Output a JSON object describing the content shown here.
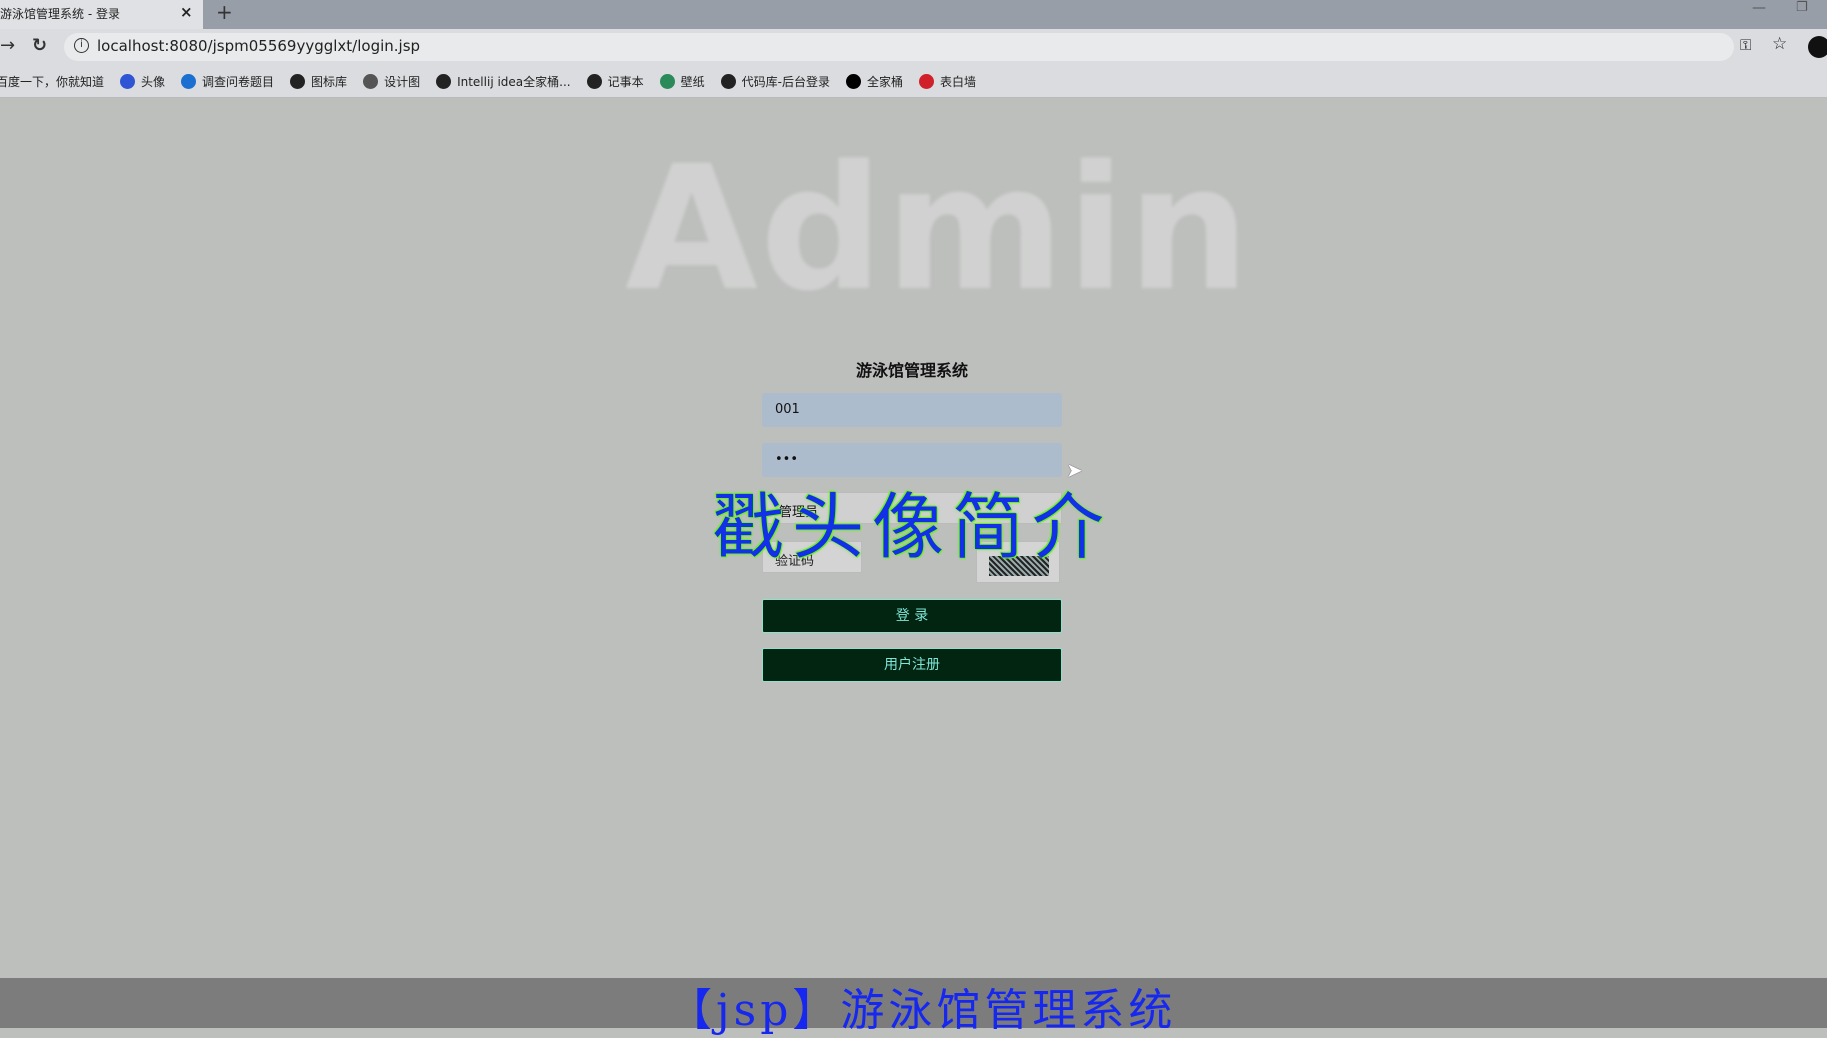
{
  "browser": {
    "tab_title": "游泳馆管理系统 - 登录",
    "tab_close": "×",
    "new_tab": "+",
    "url": "localhost:8080/jspm05569yygglxt/login.jsp",
    "bookmarks": [
      {
        "label": "百度一下，你就知道",
        "icon": "baidu-icon",
        "color": "#2f55d4"
      },
      {
        "label": "头像",
        "icon": "paw-icon",
        "color": "#2f55d4"
      },
      {
        "label": "调查问卷题目",
        "icon": "survey-icon",
        "color": "#1a6fd1"
      },
      {
        "label": "图标库",
        "icon": "globe-icon",
        "color": "#222222"
      },
      {
        "label": "设计图",
        "icon": "bubble-icon",
        "color": "#555555"
      },
      {
        "label": "Intellij idea全家桶...",
        "icon": "globe-icon",
        "color": "#222222"
      },
      {
        "label": "记事本",
        "icon": "globe-icon",
        "color": "#222222"
      },
      {
        "label": "壁纸",
        "icon": "check-circle-icon",
        "color": "#2a8a5a"
      },
      {
        "label": "代码库-后台登录",
        "icon": "globe-icon",
        "color": "#222222"
      },
      {
        "label": "全家桶",
        "icon": "jetbrains-icon",
        "color": "#000000"
      },
      {
        "label": "表白墙",
        "icon": "target-icon",
        "color": "#d0202a"
      }
    ]
  },
  "page": {
    "watermark": "Admin",
    "title": "游泳馆管理系统",
    "username_value": "001",
    "password_value": "•••",
    "role_value": "管理员",
    "captcha_placeholder": "验证码",
    "login_label": "登 录",
    "register_label": "用户注册"
  },
  "overlay_text": "戳头像简介",
  "caption": "【jsp】游泳馆管理系统",
  "colors": {
    "button_bg": "#022512",
    "button_text": "#7fe6d8",
    "overlay": "#1130e8",
    "caption": "#1627f0"
  }
}
